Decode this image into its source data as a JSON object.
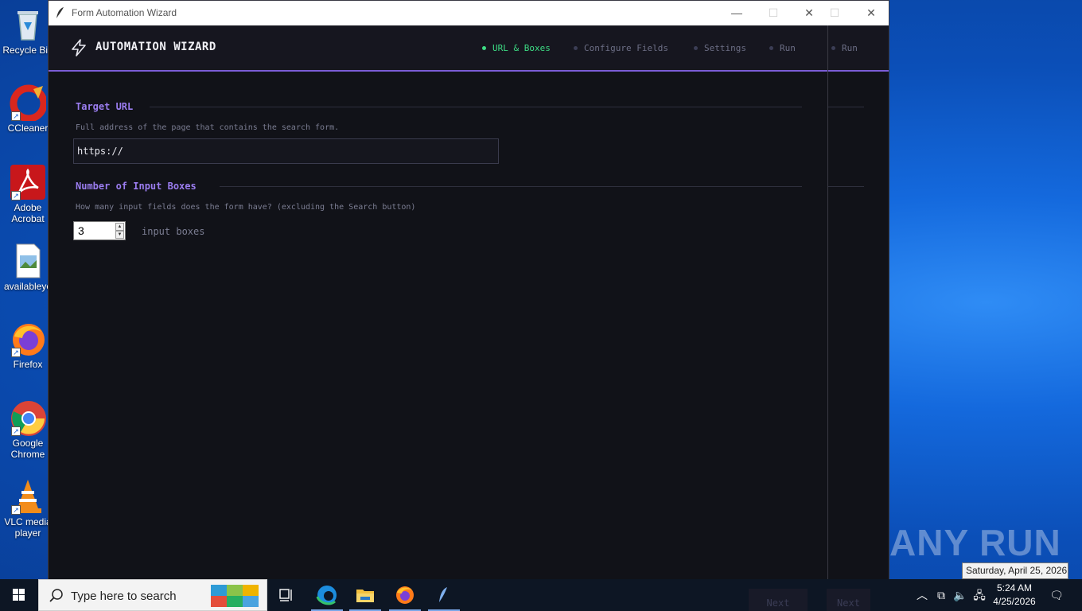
{
  "desktop": {
    "icons": [
      {
        "label": "Recycle Bin",
        "icon": "recycle-bin-icon"
      },
      {
        "label": "CCleaner",
        "icon": "ccleaner-icon"
      },
      {
        "label": "Adobe Acrobat",
        "icon": "adobe-acrobat-icon"
      },
      {
        "label": "availableye",
        "icon": "image-file-icon"
      },
      {
        "label": "Firefox",
        "icon": "firefox-icon"
      },
      {
        "label": "Google Chrome",
        "icon": "chrome-icon"
      },
      {
        "label": "VLC media player",
        "icon": "vlc-icon"
      }
    ],
    "watermark": "ANY RUN",
    "tooltip": "Saturday, April 25, 2026"
  },
  "window": {
    "title": "Form Automation Wizard",
    "app_name": "AUTOMATION WIZARD",
    "steps": [
      {
        "label": "URL & Boxes",
        "active": true
      },
      {
        "label": "Configure Fields",
        "active": false
      },
      {
        "label": "Settings",
        "active": false
      },
      {
        "label": "Run",
        "active": false
      },
      {
        "label": "Run",
        "active": false
      }
    ],
    "url_section": {
      "title": "Target URL",
      "hint": "Full address of the page that contains the search form.",
      "value": "https://"
    },
    "boxes_section": {
      "title": "Number of Input Boxes",
      "hint": "How many input fields does the form have? (excluding the Search button)",
      "value": "3",
      "unit_label": "input boxes"
    },
    "footer_buttons": [
      "Next",
      "Next"
    ]
  },
  "taskbar": {
    "search_placeholder": "Type here to search",
    "time": "5:24 AM",
    "date": "4/25/2026"
  },
  "colors": {
    "accent_purple": "#9b7df0",
    "active_green": "#3ddc84",
    "header_border": "#7b5cd6"
  }
}
